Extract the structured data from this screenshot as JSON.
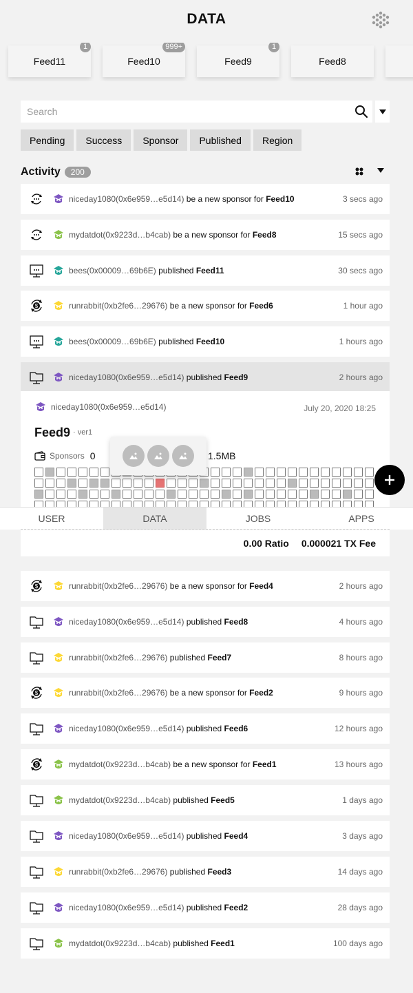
{
  "header": {
    "title": "DATA",
    "logo_icon": "hexagon-dots-logo"
  },
  "feeds": [
    {
      "label": "Feed11",
      "badge": "1"
    },
    {
      "label": "Feed10",
      "badge": "999+"
    },
    {
      "label": "Feed9",
      "badge": "1"
    },
    {
      "label": "Feed8",
      "badge": ""
    },
    {
      "label": "",
      "badge": ""
    }
  ],
  "search": {
    "placeholder": "Search",
    "value": ""
  },
  "filters": [
    "Pending",
    "Success",
    "Sponsor",
    "Published",
    "Region"
  ],
  "activity": {
    "label": "Activity",
    "count": "200"
  },
  "rows": [
    {
      "type": "sponsor",
      "avatar_color": "#7e57c2",
      "user": "niceday1080(0x6e959…e5d14)",
      "action": " be a new sponsor for ",
      "feed": "Feed10",
      "time": "3 secs ago"
    },
    {
      "type": "sponsor",
      "avatar_color": "#8bc34a",
      "user": "mydatdot(0x9223d…b4cab)",
      "action": " be a new sponsor for ",
      "feed": "Feed8",
      "time": "15 secs ago"
    },
    {
      "type": "publish",
      "avatar_color": "#26a69a",
      "user": "bees(0x00009…69b6E)",
      "action": " published ",
      "feed": "Feed11",
      "time": "30 secs ago"
    },
    {
      "type": "pay",
      "avatar_color": "#fdd835",
      "user": "runrabbit(0xb2fe6…29676)",
      "action": " be a new sponsor for ",
      "feed": "Feed6",
      "time": "1 hour ago"
    },
    {
      "type": "publish",
      "avatar_color": "#26a69a",
      "user": "bees(0x00009…69b6E)",
      "action": " published ",
      "feed": "Feed10",
      "time": "1 hours ago"
    },
    {
      "type": "folder",
      "avatar_color": "#7e57c2",
      "user": "niceday1080(0x6e959…e5d14)",
      "action": " published ",
      "feed": "Feed9",
      "time": "2 hours ago"
    },
    {
      "type": "pay",
      "avatar_color": "#fdd835",
      "user": "runrabbit(0xb2fe6…29676)",
      "action": " be a new sponsor for ",
      "feed": "Feed4",
      "time": "2 hours ago"
    },
    {
      "type": "folder",
      "avatar_color": "#7e57c2",
      "user": "niceday1080(0x6e959…e5d14)",
      "action": " published ",
      "feed": "Feed8",
      "time": "4 hours ago"
    },
    {
      "type": "folder",
      "avatar_color": "#fdd835",
      "user": "runrabbit(0xb2fe6…29676)",
      "action": " published ",
      "feed": "Feed7",
      "time": "8 hours ago"
    },
    {
      "type": "pay",
      "avatar_color": "#fdd835",
      "user": "runrabbit(0xb2fe6…29676)",
      "action": " be a new sponsor for ",
      "feed": "Feed2",
      "time": "9 hours ago"
    },
    {
      "type": "folder",
      "avatar_color": "#7e57c2",
      "user": "niceday1080(0x6e959…e5d14)",
      "action": " published ",
      "feed": "Feed6",
      "time": "12 hours ago"
    },
    {
      "type": "pay",
      "avatar_color": "#8bc34a",
      "user": "mydatdot(0x9223d…b4cab)",
      "action": " be a new sponsor for ",
      "feed": "Feed1",
      "time": "13 hours ago"
    },
    {
      "type": "folder",
      "avatar_color": "#8bc34a",
      "user": "mydatdot(0x9223d…b4cab)",
      "action": " published ",
      "feed": "Feed5",
      "time": "1 days ago"
    },
    {
      "type": "folder",
      "avatar_color": "#7e57c2",
      "user": "niceday1080(0x6e959…e5d14)",
      "action": " published ",
      "feed": "Feed4",
      "time": "3 days ago"
    },
    {
      "type": "folder",
      "avatar_color": "#fdd835",
      "user": "runrabbit(0xb2fe6…29676)",
      "action": " published ",
      "feed": "Feed3",
      "time": "14 days ago"
    },
    {
      "type": "folder",
      "avatar_color": "#7e57c2",
      "user": "niceday1080(0x6e959…e5d14)",
      "action": " published ",
      "feed": "Feed2",
      "time": "28 days ago"
    },
    {
      "type": "folder",
      "avatar_color": "#8bc34a",
      "user": "mydatdot(0x9223d…b4cab)",
      "action": " published ",
      "feed": "Feed1",
      "time": "100 days ago"
    }
  ],
  "detail": {
    "user": "niceday1080(0x6e959…e5d14)",
    "avatar_color": "#7e57c2",
    "date": "July 20, 2020 18:25",
    "title": "Feed9",
    "version": "· ver1",
    "sponsors_label": "Sponsors",
    "sponsors_value": "0",
    "size": "1.5MB",
    "grid_filled": [
      [
        0,
        1
      ],
      [
        0,
        8
      ],
      [
        0,
        19
      ],
      [
        1,
        3
      ],
      [
        1,
        5
      ],
      [
        1,
        6
      ],
      [
        1,
        15
      ],
      [
        1,
        23
      ],
      [
        2,
        0
      ],
      [
        2,
        4
      ],
      [
        2,
        7
      ],
      [
        2,
        12
      ],
      [
        2,
        17
      ],
      [
        2,
        19
      ],
      [
        2,
        25
      ],
      [
        2,
        28
      ]
    ],
    "grid_highlight": [
      [
        1,
        11
      ]
    ]
  },
  "popover": {
    "images": [
      "image-icon",
      "image-icon",
      "image-icon"
    ]
  },
  "fab": {
    "icon": "plus-icon"
  },
  "nav": [
    {
      "label": "USER",
      "active": false
    },
    {
      "label": "DATA",
      "active": true
    },
    {
      "label": "JOBS",
      "active": false
    },
    {
      "label": "APPS",
      "active": false
    }
  ],
  "stats": {
    "ratio": "0.00 Ratio",
    "fee": "0.000021 TX Fee"
  }
}
